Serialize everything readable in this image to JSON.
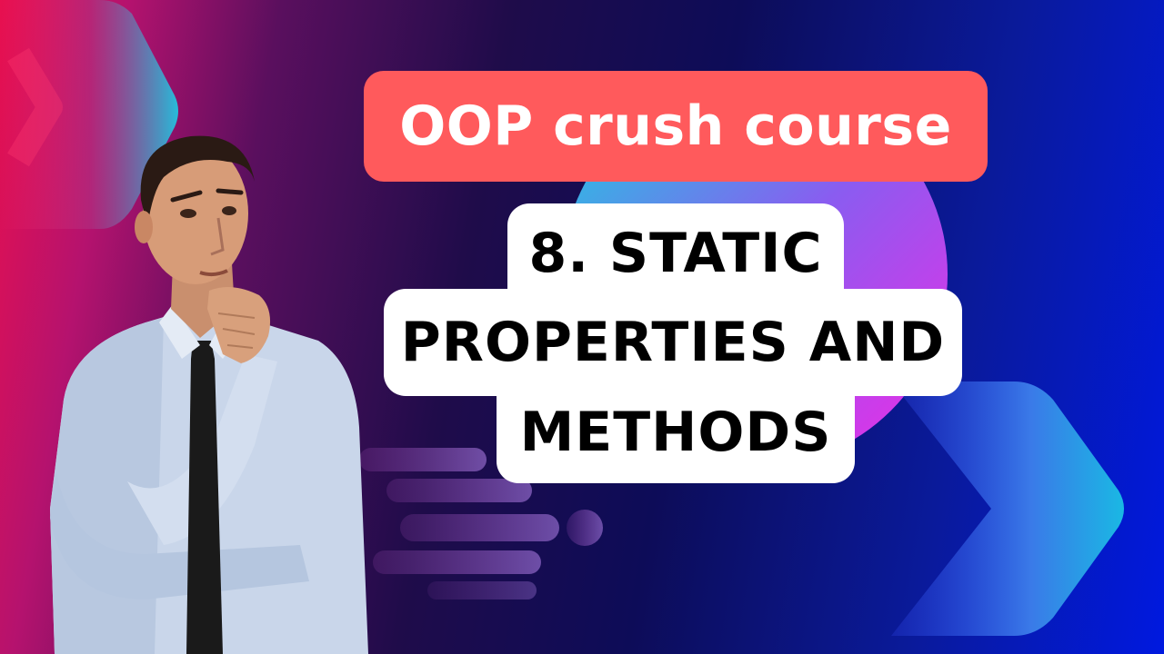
{
  "title": "OOP crush course",
  "subtitle_lines": [
    "8. STATIC",
    "PROPERTIES AND",
    "METHODS"
  ],
  "colors": {
    "title_pill": "#ff5a5c",
    "subtitle_box": "#ffffff",
    "accent_cyan": "#18c8e6",
    "accent_magenta": "#d93ef0"
  },
  "icons": [
    "chevron-arrow-icon",
    "speed-lines-icon",
    "thinking-man-photo"
  ]
}
